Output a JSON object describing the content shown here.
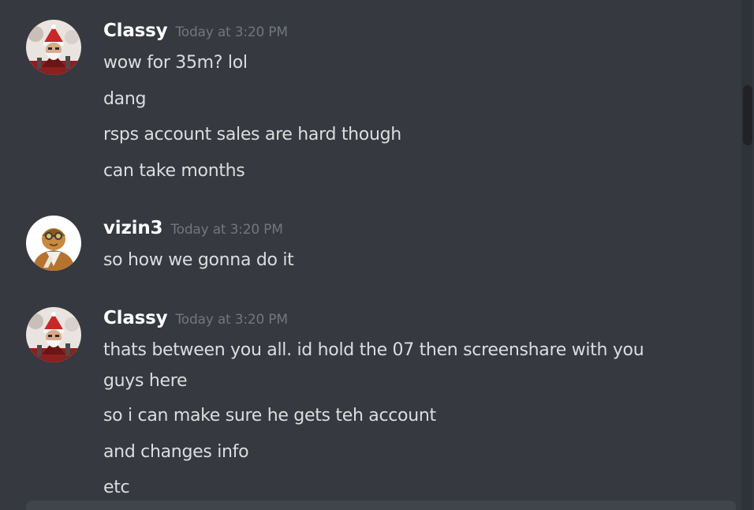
{
  "colors": {
    "background": "#36393f",
    "author": "#ffffff",
    "timestamp": "#72767d",
    "message_text": "#dcddde",
    "scrollbar_track": "#2e3338",
    "scrollbar_thumb": "#202225",
    "composer": "#40444b"
  },
  "messages": [
    {
      "author": "Classy",
      "timestamp": "Today at 3:20 PM",
      "avatar_icon": "santa-character-avatar",
      "lines": [
        "wow for 35m? lol",
        "dang",
        "rsps account sales are hard though",
        "can take months"
      ]
    },
    {
      "author": "vizin3",
      "timestamp": "Today at 3:20 PM",
      "avatar_icon": "aviator-character-avatar",
      "lines": [
        "so how we gonna do it"
      ]
    },
    {
      "author": "Classy",
      "timestamp": "Today at 3:20 PM",
      "avatar_icon": "santa-character-avatar",
      "lines": [
        "thats between you all. id hold the 07 then screenshare with you guys here",
        "so i can make sure he gets teh account",
        "and changes info",
        "etc"
      ]
    }
  ]
}
